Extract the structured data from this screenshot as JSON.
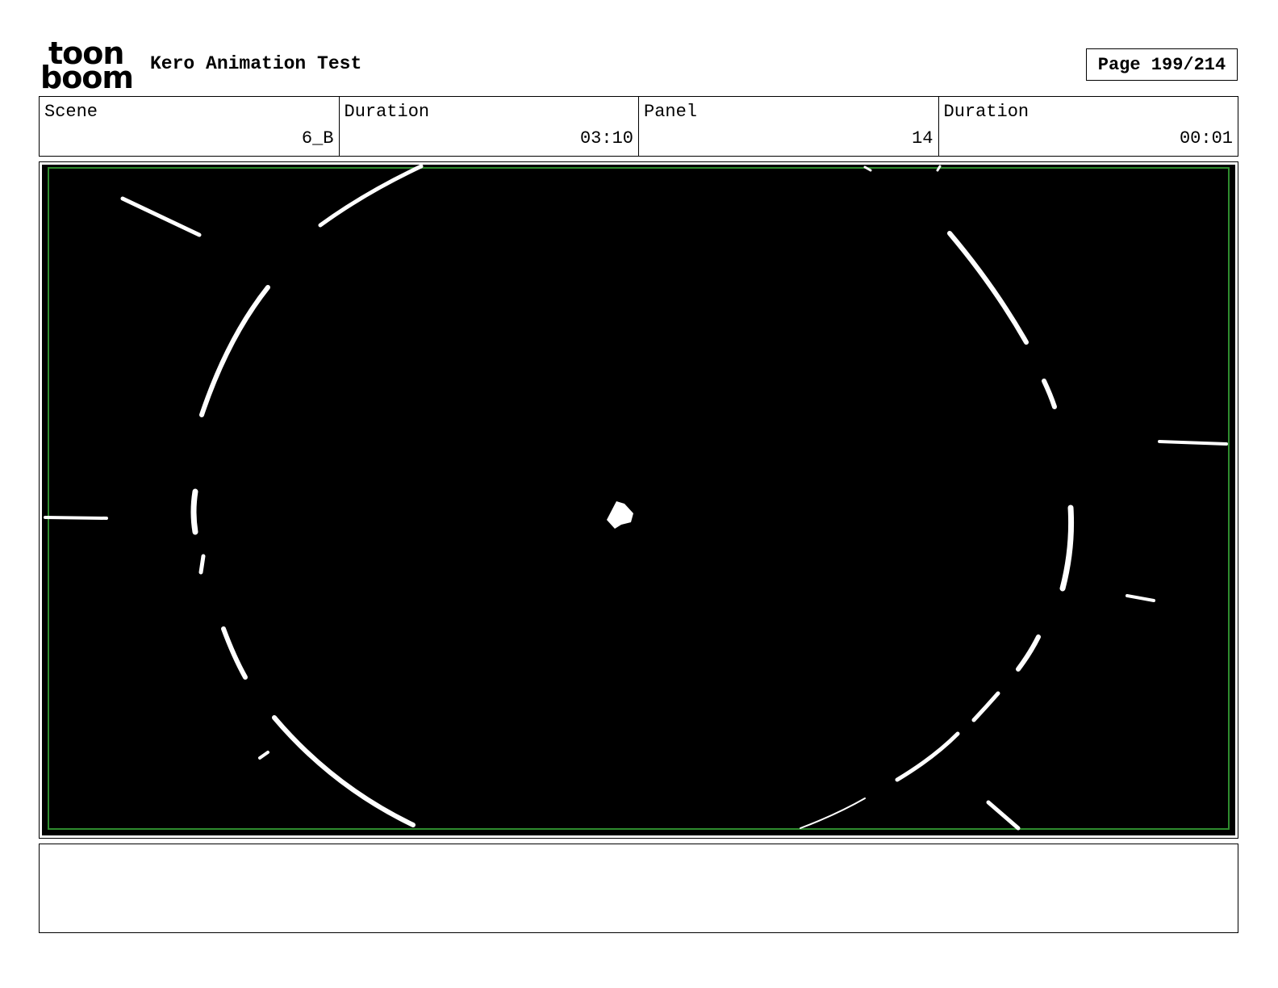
{
  "header": {
    "logo_top": "toon",
    "logo_bottom": "boom",
    "project_title": "Kero Animation Test",
    "page_label": "Page 199/214"
  },
  "info": {
    "scene_label": "Scene",
    "scene_value": "6_B",
    "scene_duration_label": "Duration",
    "scene_duration_value": "03:10",
    "panel_label": "Panel",
    "panel_value": "14",
    "panel_duration_label": "Duration",
    "panel_duration_value": "00:01"
  },
  "panel": {
    "background_color": "#000000",
    "safe_frame_color": "#2e8b2e",
    "stroke_color": "#ffffff"
  },
  "notes": {
    "text": ""
  }
}
